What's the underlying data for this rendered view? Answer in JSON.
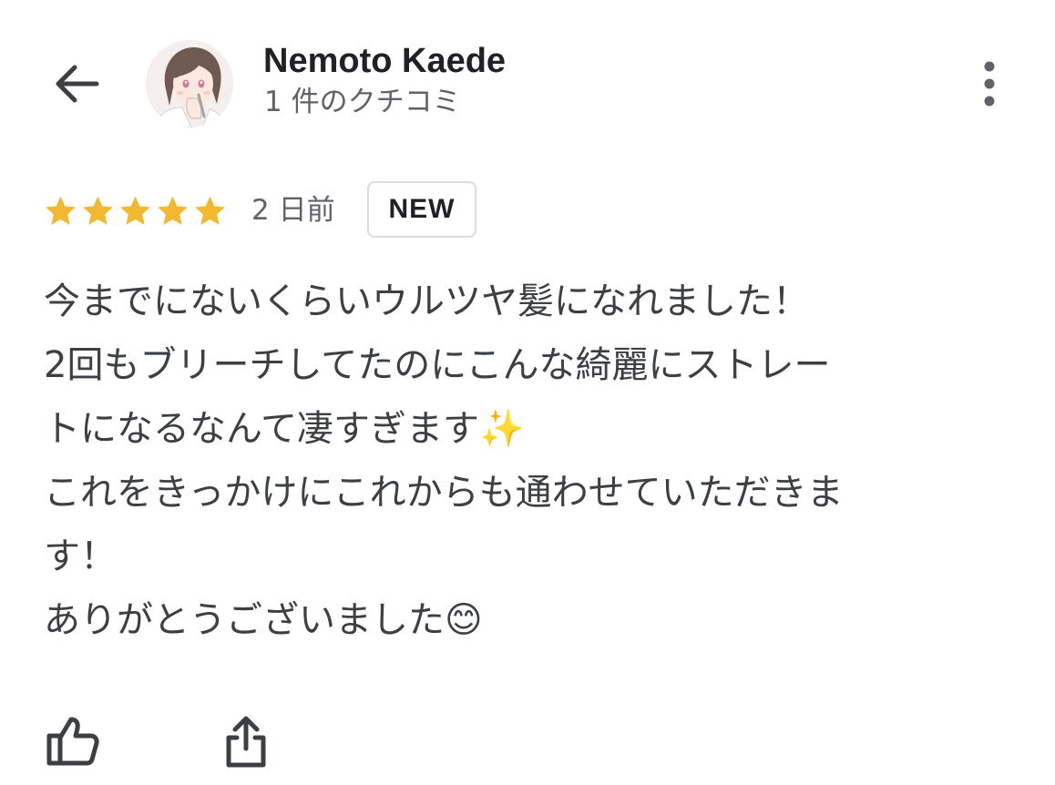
{
  "header": {
    "back_icon": "arrow-left-icon",
    "user_name": "Nemoto Kaede",
    "review_count": "1 件のクチコミ",
    "more_icon": "more-vert-icon"
  },
  "review": {
    "rating": 5,
    "rating_max": 5,
    "star_color": "#f2b830",
    "date": "2 日前",
    "badge": "NEW",
    "lines": [
      "今までにないくらいウルツヤ髪になれました！",
      "2回もブリーチしてたのにこんな綺麗にストレー",
      "トになるなんて凄すぎます✨",
      "これをきっかけにこれからも通わせていただきま",
      "す！",
      "ありがとうございました😊"
    ]
  },
  "actions": {
    "like_icon": "thumbs-up-icon",
    "share_icon": "share-icon"
  },
  "colors": {
    "primary_text": "#202124",
    "secondary_text": "#5f6368",
    "body_text": "#3c4043",
    "badge_border": "#dadce0"
  }
}
